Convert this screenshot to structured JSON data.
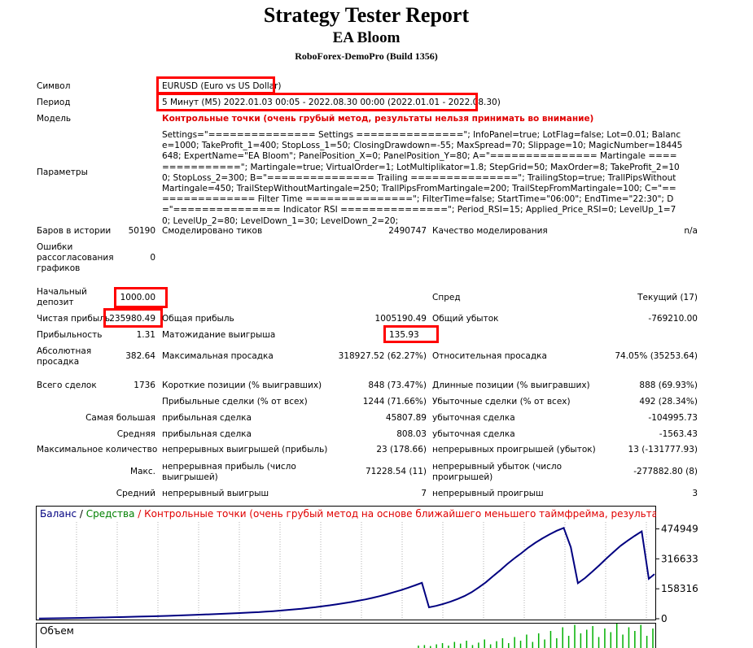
{
  "header": {
    "title": "Strategy Tester Report",
    "ea_name": "EA Bloom",
    "broker": "RoboForex-DemoPro (Build 1356)"
  },
  "info": {
    "symbol_label": "Символ",
    "symbol_value": "EURUSD (Euro vs US Dollar)",
    "period_label": "Период",
    "period_value": "5 Минут (M5) 2022.01.03 00:05 - 2022.08.30 00:00 (2022.01.01 - 2022.08.30)",
    "model_label": "Модель",
    "model_value": "Контрольные точки (очень грубый метод, результаты нельзя принимать во внимание)",
    "params_label": "Параметры",
    "params_value": "Settings=\"=============== Settings ===============\"; InfoPanel=true; LotFlag=false; Lot=0.01; Balance=1000; TakeProfit_1=400; StopLoss_1=50; ClosingDrawdown=-55; MaxSpread=70; Slippage=10; MagicNumber=18445648; ExpertName=\"EA Bloom\"; PanelPosition_X=0; PanelPosition_Y=80; A=\"=============== Martingale ===============\"; Martingale=true; VirtualOrder=1; LotMultiplikator=1.8; StepGrid=50; MaxOrder=8; TakeProfit_2=100; StopLoss_2=300; B=\"=============== Trailing ===============\"; TrailingStop=true; TrallPipsWithoutMartingale=450; TrailStepWithoutMartingale=250; TrallPipsFromMartingale=200; TrailStepFromMartingale=100; C=\"=============== Filter Time ===============\"; FilterTime=false; StartTime=\"06:00\"; EndTime=\"22:30\"; D=\"=============== Indicator RSI ===============\"; Period_RSI=15; Applied_Price_RSI=0; LevelUp_1=70; LevelUp_2=80; LevelDown_1=30; LevelDown_2=20;"
  },
  "stats": {
    "bars_label": "Баров в истории",
    "bars_value": "50190",
    "ticks_label": "Смоделировано тиков",
    "ticks_value": "2490747",
    "quality_label": "Качество моделирования",
    "quality_value": "n/a",
    "errors_label_1": "Ошибки",
    "errors_label_2": "рассогласования",
    "errors_label_3": "графиков",
    "errors_value": "0",
    "deposit_label_1": "Начальный",
    "deposit_label_2": "депозит",
    "deposit_value": "1000.00",
    "spread_label": "Спред",
    "spread_value": "Текущий (17)",
    "net_label": "Чистая прибыль",
    "net_value": "235980.49",
    "gross_profit_label": "Общая прибыль",
    "gross_profit_value": "1005190.49",
    "gross_loss_label": "Общий убыток",
    "gross_loss_value": "-769210.00",
    "pf_label": "Прибыльность",
    "pf_value": "1.31",
    "expected_label": "Матожидание выигрыша",
    "expected_value": "135.93",
    "abs_dd_label_1": "Абсолютная",
    "abs_dd_label_2": "просадка",
    "abs_dd_value": "382.64",
    "max_dd_label": "Максимальная просадка",
    "max_dd_value": "318927.52 (62.27%)",
    "rel_dd_label": "Относительная просадка",
    "rel_dd_value": "74.05% (35253.64)",
    "trades_label": "Всего сделок",
    "trades_value": "1736",
    "short_label": "Короткие позиции (% выигравших)",
    "short_value": "848 (73.47%)",
    "long_label": "Длинные позиции (% выигравших)",
    "long_value": "888 (69.93%)",
    "profit_trades_label": "Прибыльные сделки (% от всех)",
    "profit_trades_value": "1244 (71.66%)",
    "loss_trades_label": "Убыточные сделки (% от всех)",
    "loss_trades_value": "492 (28.34%)",
    "largest_label": "Самая большая",
    "largest_profit_label": "прибыльная сделка",
    "largest_profit_value": "45807.89",
    "largest_loss_label": "убыточная сделка",
    "largest_loss_value": "-104995.73",
    "average_label": "Средняя",
    "average_profit_label": "прибыльная сделка",
    "average_profit_value": "808.03",
    "average_loss_label": "убыточная сделка",
    "average_loss_value": "-1563.43",
    "max_count_label": "Максимальное количество",
    "max_cons_wins_label": "непрерывных выигрышей (прибыль)",
    "max_cons_wins_value": "23 (178.66)",
    "max_cons_losses_label": "непрерывных проигрышей (убыток)",
    "max_cons_losses_value": "13 (-131777.93)",
    "max_label": "Макс.",
    "max_cons_profit_label_1": "непрерывная прибыль (число",
    "max_cons_profit_label_2": "выигрышей)",
    "max_cons_profit_value": "71228.54 (11)",
    "max_cons_loss_label_1": "непрерывный убыток (число",
    "max_cons_loss_label_2": "проигрышей)",
    "max_cons_loss_value": "-277882.80 (8)",
    "avg_label": "Средний",
    "avg_cons_wins_label": "непрерывный выигрыш",
    "avg_cons_wins_value": "7",
    "avg_cons_losses_label": "непрерывный проигрыш",
    "avg_cons_losses_value": "3"
  },
  "chart_data": {
    "type": "line",
    "legend_balance": "Баланс",
    "legend_sep": " / ",
    "legend_equity": "Средства",
    "legend_model": " / Контрольные точки (очень грубый метод на основе ближайшего меньшего таймфрейма, результаты нельзя пр",
    "volume_label": "Объем",
    "yticks": [
      "474949",
      "316633",
      "158316",
      "0"
    ],
    "ylim": [
      0,
      520000
    ],
    "colors": {
      "balance": "#000080",
      "equity": "#008000",
      "model": "#e00000",
      "volume": "#00b000"
    },
    "series": [
      {
        "name": "Баланс",
        "x": [
          0,
          40,
          80,
          120,
          160,
          200,
          240,
          280,
          320,
          360,
          400,
          440,
          480,
          520,
          560,
          600,
          620,
          640,
          660,
          680,
          700,
          720,
          740,
          760,
          780,
          800,
          820,
          840,
          860,
          880,
          900,
          920,
          940,
          960,
          980,
          1000,
          1020,
          1040,
          1060,
          1080,
          1100,
          1120,
          1140,
          1160,
          1180,
          1200,
          1220,
          1240,
          1260,
          1280,
          1300,
          1320,
          1340,
          1360,
          1380,
          1400,
          1420,
          1440,
          1460,
          1480,
          1500,
          1520,
          1540,
          1560,
          1580,
          1600,
          1620,
          1640,
          1660,
          1680,
          1700,
          1720,
          1736
        ],
        "values": [
          1000,
          2000,
          3200,
          4500,
          6000,
          7500,
          9000,
          11000,
          13000,
          15000,
          17500,
          20000,
          23000,
          26000,
          29500,
          33000,
          35000,
          37500,
          40000,
          43000,
          46000,
          49500,
          53000,
          57000,
          61000,
          66000,
          71000,
          76500,
          82000,
          88000,
          95000,
          102000,
          110000,
          119000,
          129000,
          140000,
          151000,
          163000,
          176000,
          190000,
          60000,
          68000,
          78000,
          90000,
          104000,
          120000,
          140000,
          165000,
          192000,
          224000,
          255000,
          288000,
          318000,
          346000,
          376000,
          402000,
          425000,
          446000,
          465000,
          480000,
          378000,
          188000,
          215000,
          248000,
          282000,
          318000,
          352000,
          385000,
          412000,
          438000,
          462000,
          211000,
          236000
        ]
      }
    ],
    "volume": [
      0.1,
      0.12,
      0.08,
      0.15,
      0.2,
      0.1,
      0.25,
      0.18,
      0.3,
      0.12,
      0.22,
      0.35,
      0.15,
      0.28,
      0.4,
      0.2,
      0.45,
      0.3,
      0.55,
      0.25,
      0.6,
      0.35,
      0.7,
      0.4,
      0.85,
      0.5,
      0.95,
      0.6,
      0.75,
      0.9,
      0.45,
      0.8,
      0.65,
      1.0,
      0.55,
      0.85,
      0.7,
      0.95,
      0.5,
      0.8
    ]
  }
}
